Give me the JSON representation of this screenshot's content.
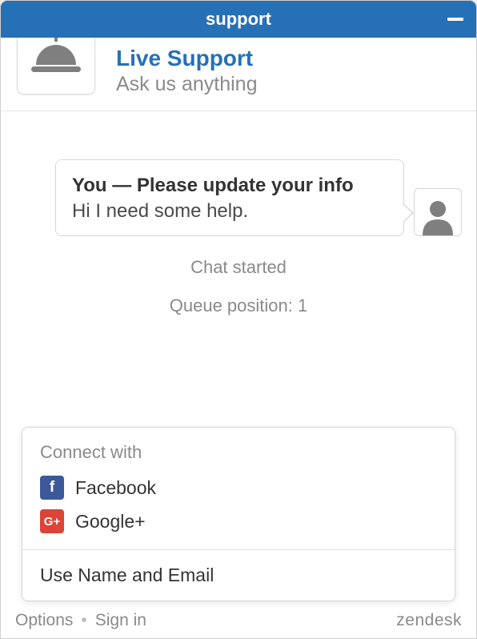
{
  "titlebar": {
    "title": "support"
  },
  "header": {
    "title": "Live Support",
    "subtitle": "Ask us anything"
  },
  "chat": {
    "message": {
      "header": "You — Please update your info",
      "body": "Hi I need some help."
    },
    "status1": "Chat started",
    "status2": "Queue position: 1"
  },
  "connect": {
    "label": "Connect with",
    "facebook": "Facebook",
    "google": "Google+",
    "name_email": "Use Name and Email"
  },
  "footer": {
    "options": "Options",
    "signin": "Sign in",
    "brand": "zendesk"
  }
}
